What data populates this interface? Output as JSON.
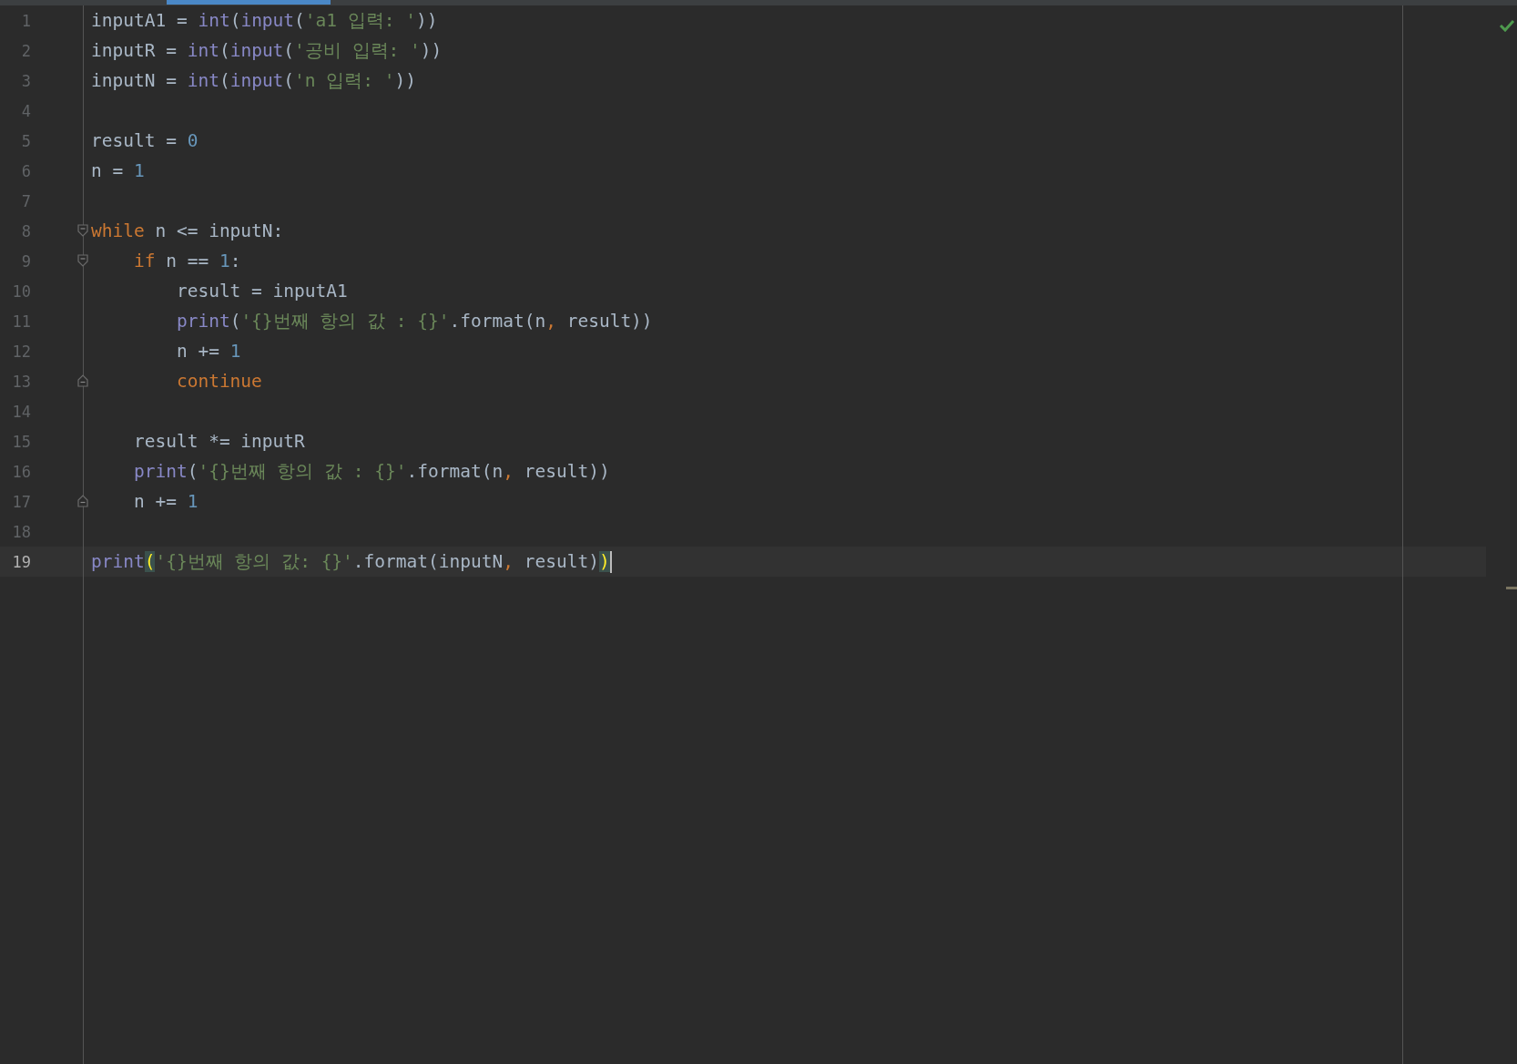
{
  "editor": {
    "lines": [
      {
        "number": "1",
        "current": false,
        "fold_start": false,
        "fold_end": false,
        "tokens": [
          {
            "kind": "plain",
            "text": "inputA1 = "
          },
          {
            "kind": "builtin",
            "text": "int"
          },
          {
            "kind": "plain",
            "text": "("
          },
          {
            "kind": "builtin",
            "text": "input"
          },
          {
            "kind": "plain",
            "text": "("
          },
          {
            "kind": "string",
            "text": "'a1 입력: '"
          },
          {
            "kind": "plain",
            "text": "))"
          }
        ]
      },
      {
        "number": "2",
        "current": false,
        "fold_start": false,
        "fold_end": false,
        "tokens": [
          {
            "kind": "plain",
            "text": "inputR = "
          },
          {
            "kind": "builtin",
            "text": "int"
          },
          {
            "kind": "plain",
            "text": "("
          },
          {
            "kind": "builtin",
            "text": "input"
          },
          {
            "kind": "plain",
            "text": "("
          },
          {
            "kind": "string",
            "text": "'공비 입력: '"
          },
          {
            "kind": "plain",
            "text": "))"
          }
        ]
      },
      {
        "number": "3",
        "current": false,
        "fold_start": false,
        "fold_end": false,
        "tokens": [
          {
            "kind": "plain",
            "text": "inputN = "
          },
          {
            "kind": "builtin",
            "text": "int"
          },
          {
            "kind": "plain",
            "text": "("
          },
          {
            "kind": "builtin",
            "text": "input"
          },
          {
            "kind": "plain",
            "text": "("
          },
          {
            "kind": "string",
            "text": "'n 입력: '"
          },
          {
            "kind": "plain",
            "text": "))"
          }
        ]
      },
      {
        "number": "4",
        "current": false,
        "fold_start": false,
        "fold_end": false
      },
      {
        "number": "5",
        "current": false,
        "fold_start": false,
        "fold_end": false,
        "tokens": [
          {
            "kind": "plain",
            "text": "result = "
          },
          {
            "kind": "number",
            "text": "0"
          }
        ]
      },
      {
        "number": "6",
        "current": false,
        "fold_start": false,
        "fold_end": false,
        "tokens": [
          {
            "kind": "plain",
            "text": "n = "
          },
          {
            "kind": "number",
            "text": "1"
          }
        ]
      },
      {
        "number": "7",
        "current": false,
        "fold_start": false,
        "fold_end": false
      },
      {
        "number": "8",
        "current": false,
        "fold_start": true,
        "fold_end": false,
        "tokens": [
          {
            "kind": "keyword",
            "text": "while"
          },
          {
            "kind": "plain",
            "text": " n <= inputN:"
          }
        ]
      },
      {
        "number": "9",
        "current": false,
        "fold_start": true,
        "fold_end": false,
        "tokens": [
          {
            "kind": "keyword",
            "text": "    if"
          },
          {
            "kind": "plain",
            "text": " n == "
          },
          {
            "kind": "number",
            "text": "1"
          },
          {
            "kind": "plain",
            "text": ":"
          }
        ]
      },
      {
        "number": "10",
        "current": false,
        "fold_start": false,
        "fold_end": false,
        "tokens": [
          {
            "kind": "plain",
            "text": "        result = inputA1"
          }
        ]
      },
      {
        "number": "11",
        "current": false,
        "fold_start": false,
        "fold_end": false,
        "tokens": [
          {
            "kind": "builtin",
            "text": "        print"
          },
          {
            "kind": "plain",
            "text": "("
          },
          {
            "kind": "string",
            "text": "'{}번째 항의 값 : {}'"
          },
          {
            "kind": "plain",
            "text": ".format(n"
          },
          {
            "kind": "keyword",
            "text": ","
          },
          {
            "kind": "plain",
            "text": " result))"
          }
        ]
      },
      {
        "number": "12",
        "current": false,
        "fold_start": false,
        "fold_end": false,
        "tokens": [
          {
            "kind": "plain",
            "text": "        n += "
          },
          {
            "kind": "number",
            "text": "1"
          }
        ]
      },
      {
        "number": "13",
        "current": false,
        "fold_start": false,
        "fold_end": true,
        "tokens": [
          {
            "kind": "keyword",
            "text": "        continue"
          }
        ]
      },
      {
        "number": "14",
        "current": false,
        "fold_start": false,
        "fold_end": false
      },
      {
        "number": "15",
        "current": false,
        "fold_start": false,
        "fold_end": false,
        "tokens": [
          {
            "kind": "plain",
            "text": "    result *= inputR"
          }
        ]
      },
      {
        "number": "16",
        "current": false,
        "fold_start": false,
        "fold_end": false,
        "tokens": [
          {
            "kind": "builtin",
            "text": "    print"
          },
          {
            "kind": "plain",
            "text": "("
          },
          {
            "kind": "string",
            "text": "'{}번째 항의 값 : {}'"
          },
          {
            "kind": "plain",
            "text": ".format(n"
          },
          {
            "kind": "keyword",
            "text": ","
          },
          {
            "kind": "plain",
            "text": " result))"
          }
        ]
      },
      {
        "number": "17",
        "current": false,
        "fold_start": false,
        "fold_end": true,
        "tokens": [
          {
            "kind": "plain",
            "text": "    n += "
          },
          {
            "kind": "number",
            "text": "1"
          }
        ]
      },
      {
        "number": "18",
        "current": false,
        "fold_start": false,
        "fold_end": false
      },
      {
        "number": "19",
        "current": true,
        "fold_start": false,
        "fold_end": false,
        "tokens": [
          {
            "kind": "builtin",
            "text": "print"
          },
          {
            "kind": "match",
            "text": "("
          },
          {
            "kind": "string",
            "text": "'{}번째 항의 값: {}'"
          },
          {
            "kind": "plain",
            "text": ".format(inputN"
          },
          {
            "kind": "keyword",
            "text": ","
          },
          {
            "kind": "plain",
            "text": " result)"
          },
          {
            "kind": "match",
            "text": ")"
          }
        ]
      }
    ]
  }
}
